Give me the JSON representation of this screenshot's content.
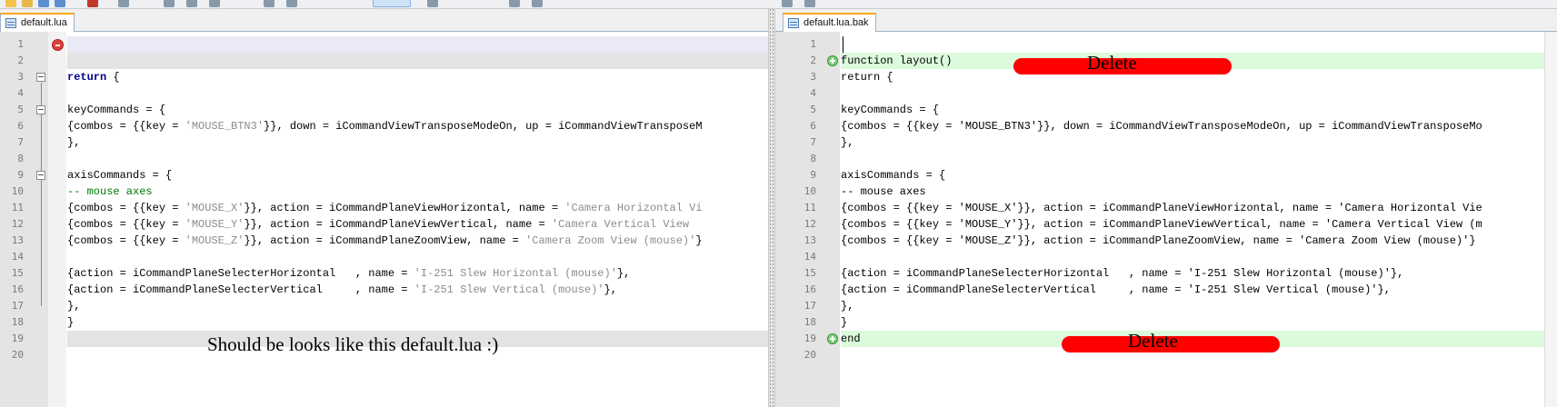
{
  "tabs": {
    "left": "default.lua",
    "right": "default.lua.bak"
  },
  "left_lines": [
    {
      "n": "1",
      "parts": []
    },
    {
      "n": "2",
      "parts": []
    },
    {
      "n": "3",
      "parts": [
        {
          "t": "return",
          "c": "kw"
        },
        {
          "t": " {"
        }
      ]
    },
    {
      "n": "4",
      "parts": []
    },
    {
      "n": "5",
      "parts": [
        {
          "t": "keyCommands = {"
        }
      ]
    },
    {
      "n": "6",
      "parts": [
        {
          "t": "{combos = {{key = "
        },
        {
          "t": "'MOUSE_BTN3'",
          "c": "str"
        },
        {
          "t": "}}, down = iCommandViewTransposeModeOn, up = iCommandViewTransposeM"
        }
      ]
    },
    {
      "n": "7",
      "parts": [
        {
          "t": "},"
        }
      ]
    },
    {
      "n": "8",
      "parts": []
    },
    {
      "n": "9",
      "parts": [
        {
          "t": "axisCommands = {"
        }
      ]
    },
    {
      "n": "10",
      "parts": [
        {
          "t": "-- mouse axes",
          "c": "cm"
        }
      ]
    },
    {
      "n": "11",
      "parts": [
        {
          "t": "{combos = {{key = "
        },
        {
          "t": "'MOUSE_X'",
          "c": "str"
        },
        {
          "t": "}}, action = iCommandPlaneViewHorizontal, name = "
        },
        {
          "t": "'Camera Horizontal Vi",
          "c": "str"
        }
      ]
    },
    {
      "n": "12",
      "parts": [
        {
          "t": "{combos = {{key = "
        },
        {
          "t": "'MOUSE_Y'",
          "c": "str"
        },
        {
          "t": "}}, action = iCommandPlaneViewVertical, name = "
        },
        {
          "t": "'Camera Vertical View ",
          "c": "str"
        }
      ]
    },
    {
      "n": "13",
      "parts": [
        {
          "t": "{combos = {{key = "
        },
        {
          "t": "'MOUSE_Z'",
          "c": "str"
        },
        {
          "t": "}}, action = iCommandPlaneZoomView, name = "
        },
        {
          "t": "'Camera Zoom View (mouse)'",
          "c": "str"
        },
        {
          "t": "}"
        }
      ]
    },
    {
      "n": "14",
      "parts": []
    },
    {
      "n": "15",
      "parts": [
        {
          "t": "{action = iCommandPlaneSelecterHorizontal   , name = "
        },
        {
          "t": "'I-251 Slew Horizontal (mouse)'",
          "c": "str"
        },
        {
          "t": "},"
        }
      ]
    },
    {
      "n": "16",
      "parts": [
        {
          "t": "{action = iCommandPlaneSelecterVertical     , name = "
        },
        {
          "t": "'I-251 Slew Vertical (mouse)'",
          "c": "str"
        },
        {
          "t": "},"
        }
      ]
    },
    {
      "n": "17",
      "parts": [
        {
          "t": "},"
        }
      ]
    },
    {
      "n": "18",
      "parts": [
        {
          "t": "}"
        }
      ]
    },
    {
      "n": "19",
      "parts": []
    },
    {
      "n": "20",
      "parts": []
    }
  ],
  "right_lines": [
    {
      "n": "1",
      "parts": []
    },
    {
      "n": "2",
      "parts": [
        {
          "t": "function layout()"
        }
      ]
    },
    {
      "n": "3",
      "parts": [
        {
          "t": "return {"
        }
      ]
    },
    {
      "n": "4",
      "parts": []
    },
    {
      "n": "5",
      "parts": [
        {
          "t": "keyCommands = {"
        }
      ]
    },
    {
      "n": "6",
      "parts": [
        {
          "t": "{combos = {{key = 'MOUSE_BTN3'}}, down = iCommandViewTransposeModeOn, up = iCommandViewTransposeMo"
        }
      ]
    },
    {
      "n": "7",
      "parts": [
        {
          "t": "},"
        }
      ]
    },
    {
      "n": "8",
      "parts": []
    },
    {
      "n": "9",
      "parts": [
        {
          "t": "axisCommands = {"
        }
      ]
    },
    {
      "n": "10",
      "parts": [
        {
          "t": "-- mouse axes"
        }
      ]
    },
    {
      "n": "11",
      "parts": [
        {
          "t": "{combos = {{key = 'MOUSE_X'}}, action = iCommandPlaneViewHorizontal, name = 'Camera Horizontal Vie"
        }
      ]
    },
    {
      "n": "12",
      "parts": [
        {
          "t": "{combos = {{key = 'MOUSE_Y'}}, action = iCommandPlaneViewVertical, name = 'Camera Vertical View (m"
        }
      ]
    },
    {
      "n": "13",
      "parts": [
        {
          "t": "{combos = {{key = 'MOUSE_Z'}}, action = iCommandPlaneZoomView, name = 'Camera Zoom View (mouse)'}"
        }
      ]
    },
    {
      "n": "14",
      "parts": []
    },
    {
      "n": "15",
      "parts": [
        {
          "t": "{action = iCommandPlaneSelecterHorizontal   , name = 'I-251 Slew Horizontal (mouse)'},"
        }
      ]
    },
    {
      "n": "16",
      "parts": [
        {
          "t": "{action = iCommandPlaneSelecterVertical     , name = 'I-251 Slew Vertical (mouse)'},"
        }
      ]
    },
    {
      "n": "17",
      "parts": [
        {
          "t": "},"
        }
      ]
    },
    {
      "n": "18",
      "parts": [
        {
          "t": "}"
        }
      ]
    },
    {
      "n": "19",
      "parts": [
        {
          "t": "end"
        }
      ]
    },
    {
      "n": "20",
      "parts": []
    }
  ],
  "annotations": {
    "left_note": "Should be looks like this default.lua :)",
    "delete_top": "Delete",
    "delete_bottom": "Delete"
  },
  "colors": {
    "deleted_line_bg": "#e9e9f7",
    "added_line_bg": "#dcfadc",
    "empty_line_bg": "#e3e3e3",
    "highlight_red": "#ff0000",
    "active_tab_accent": "#f8a81b"
  }
}
